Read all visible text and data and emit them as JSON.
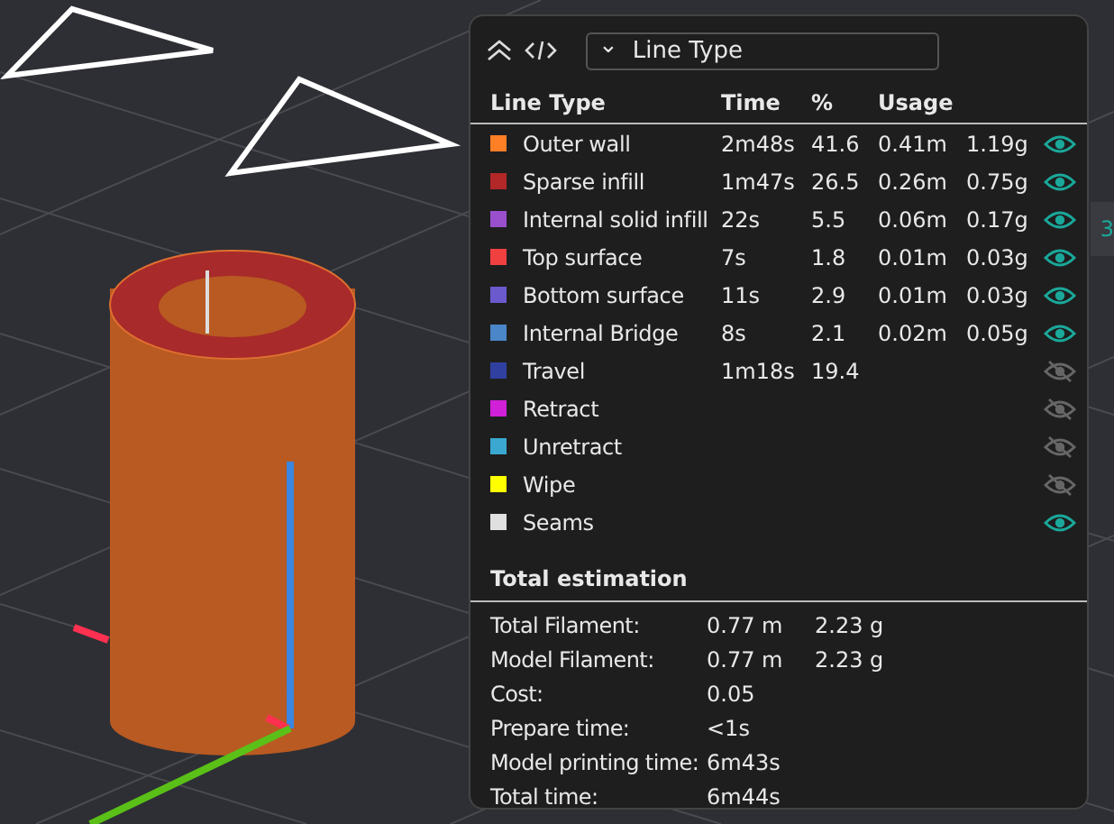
{
  "toolbar": {
    "dropdown": {
      "caret": "⌄",
      "value": "Line Type"
    }
  },
  "table": {
    "columns": [
      "Line Type",
      "Time",
      "%",
      "Usage"
    ],
    "rows": [
      {
        "name": "Outer wall",
        "color": "#ff7f27",
        "time": "2m48s",
        "percent": "41.6",
        "length": "0.41m",
        "weight": "1.19g",
        "visible": true
      },
      {
        "name": "Sparse infill",
        "color": "#b22727",
        "time": "1m47s",
        "percent": "26.5",
        "length": "0.26m",
        "weight": "0.75g",
        "visible": true
      },
      {
        "name": "Internal solid infill",
        "color": "#9a4fcc",
        "time": "22s",
        "percent": "5.5",
        "length": "0.06m",
        "weight": "0.17g",
        "visible": true
      },
      {
        "name": "Top surface",
        "color": "#f04040",
        "time": "7s",
        "percent": "1.8",
        "length": "0.01m",
        "weight": "0.03g",
        "visible": true
      },
      {
        "name": "Bottom surface",
        "color": "#6a5acd",
        "time": "11s",
        "percent": "2.9",
        "length": "0.01m",
        "weight": "0.03g",
        "visible": true
      },
      {
        "name": "Internal Bridge",
        "color": "#4a86c8",
        "time": "8s",
        "percent": "2.1",
        "length": "0.02m",
        "weight": "0.05g",
        "visible": true
      },
      {
        "name": "Travel",
        "color": "#3040a0",
        "time": "1m18s",
        "percent": "19.4",
        "visible": false
      },
      {
        "name": "Retract",
        "color": "#d020d8",
        "visible": false
      },
      {
        "name": "Unretract",
        "color": "#3aa8d0",
        "visible": false
      },
      {
        "name": "Wipe",
        "color": "#ffff00",
        "visible": false
      },
      {
        "name": "Seams",
        "color": "#e0e0e0",
        "visible": true
      }
    ]
  },
  "estimation": {
    "title": "Total estimation",
    "rows": [
      {
        "label": "Total Filament:",
        "values": [
          "0.77 m",
          "2.23 g"
        ]
      },
      {
        "label": "Model Filament:",
        "values": [
          "0.77 m",
          "2.23 g"
        ]
      },
      {
        "label": "Cost:",
        "values": [
          "0.05"
        ]
      },
      {
        "label": "Prepare time:",
        "values": [
          "<1s"
        ]
      },
      {
        "label": "Model printing time:",
        "values": [
          "6m43s"
        ]
      },
      {
        "label": "Total time:",
        "values": [
          "6m44s"
        ]
      }
    ]
  },
  "side_tab": {
    "label": "3"
  }
}
